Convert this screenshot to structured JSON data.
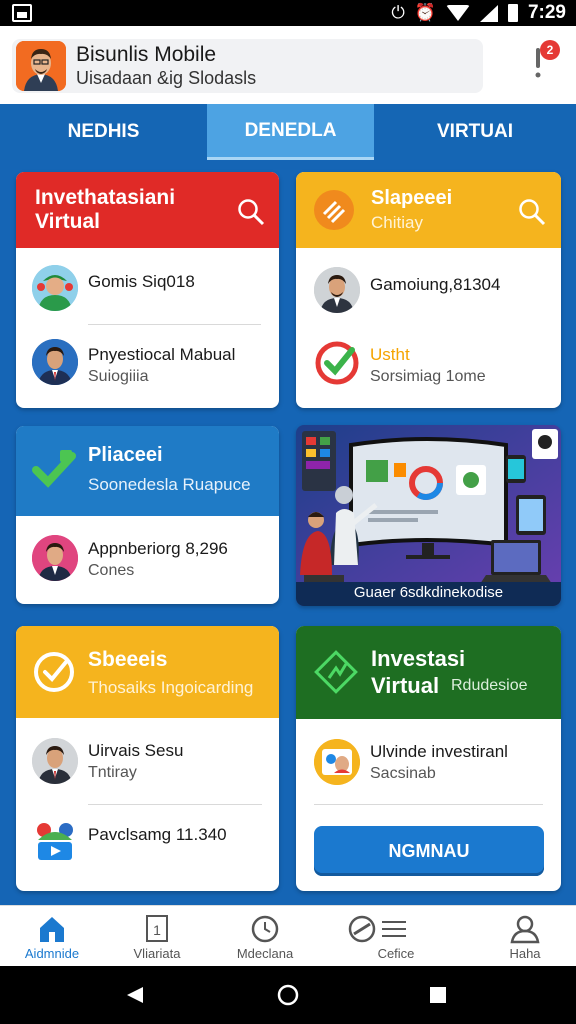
{
  "status_bar": {
    "time": "7:29"
  },
  "app_bar": {
    "title": "Bisunlis Mobile",
    "subtitle": "Uisadaan &ig Slodasls",
    "notification_count": "2"
  },
  "tabs": [
    {
      "label": "NEDHIS"
    },
    {
      "label": "DENEDLA"
    },
    {
      "label": "VIRTUAI"
    }
  ],
  "cards": {
    "c1": {
      "title": "Invethatasiani Virtual",
      "row1": {
        "title": "Gomis Siq018"
      },
      "row2": {
        "title": "Pnyestiocal Mabual",
        "sub": "Suiogiiia"
      }
    },
    "c2": {
      "title": "Slapeeei",
      "sub": "Chitiay",
      "row1": {
        "title": "Gamoiung,81304"
      },
      "row2": {
        "title": "Ustht",
        "sub": "Sorsimiag 1ome"
      }
    },
    "c3": {
      "title": "Pliaceei",
      "sub": "Soonedesla Ruapuce",
      "row1": {
        "title": "Appnberiorg 8,296",
        "sub": "Cones"
      }
    },
    "c4": {
      "caption": "Guaer 6sdkdinekodise"
    },
    "c5": {
      "title": "Sbeeeis",
      "sub": "Thosaiks Ingoicarding",
      "row1": {
        "title": "Uirvais Sesu",
        "sub": "Tntiray"
      },
      "row2": {
        "title": "Pavclsamg 11.340"
      }
    },
    "c6": {
      "title1": "Investasi",
      "title2": "Virtual",
      "sub": "Rdudesioe",
      "row1": {
        "title": "Ulvinde investiranl",
        "sub": "Sacsinab"
      },
      "button": "NGMNAU"
    }
  },
  "bottom_nav": [
    {
      "label": "Aidmnide",
      "icon": "home-icon"
    },
    {
      "label": "Vliariata",
      "icon": "document-icon"
    },
    {
      "label": "Mdeclana",
      "icon": "clock-icon"
    },
    {
      "label": "Cefice",
      "icon": "list-icon"
    },
    {
      "label": "Haha",
      "icon": "person-icon"
    }
  ],
  "colors": {
    "primary": "#1565b5",
    "red": "#e02a27",
    "yellow": "#f5b41e",
    "green": "#1e6e22",
    "active_tab": "#4da3e3"
  }
}
